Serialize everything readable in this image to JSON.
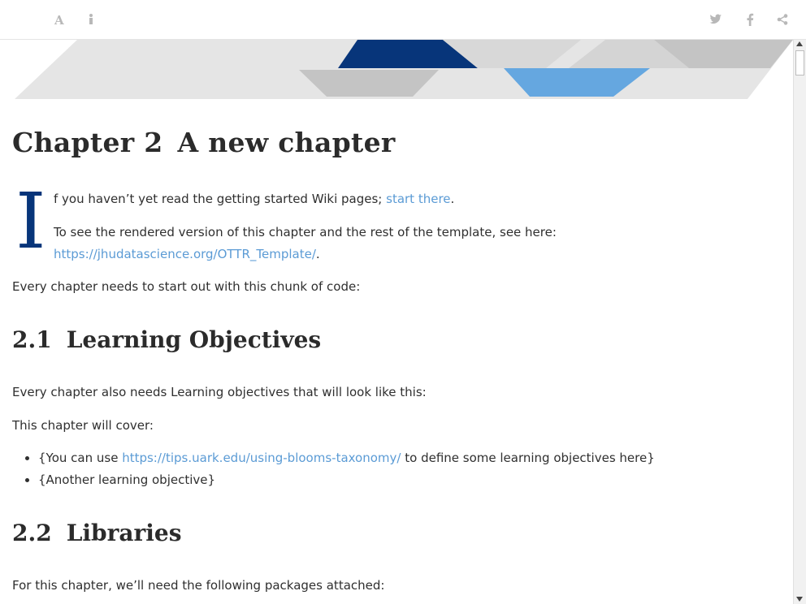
{
  "toolbar": {
    "left_icons": [
      "font-settings-icon",
      "info-icon"
    ],
    "right_icons": [
      "twitter-icon",
      "facebook-icon",
      "share-icon"
    ]
  },
  "chapter": {
    "number": "Chapter 2",
    "title": "A new chapter"
  },
  "intro": {
    "dropcap": "I",
    "first_line_rest": "f you haven’t yet read the getting started Wiki pages; ",
    "start_link": "start there",
    "period": ".",
    "rendered_text": "To see the rendered version of this chapter and the rest of the template, see here: ",
    "rendered_link": "https://jhudatascience.org/OTTR_Template/",
    "rendered_period": ".",
    "chunk_text": "Every chapter needs to start out with this chunk of code:"
  },
  "section_1": {
    "number": "2.1",
    "title": "Learning Objectives",
    "para1": "Every chapter also needs Learning objectives that will look like this:",
    "para2": "This chapter will cover:",
    "items": [
      {
        "before": "{You can use ",
        "link": "https://tips.uark.edu/using-blooms-taxonomy/",
        "after": " to define some learning objectives here}"
      },
      {
        "text": "{Another learning objective}"
      }
    ]
  },
  "section_2": {
    "number": "2.2",
    "title": "Libraries",
    "para1": "For this chapter, we’ll need the following packages attached:"
  },
  "colors": {
    "dark_blue": "#07357a",
    "light_blue": "#65a7e0",
    "gray": "#c4c4c4",
    "light_gray": "#e3e3e3",
    "link": "#5b9bd5"
  }
}
